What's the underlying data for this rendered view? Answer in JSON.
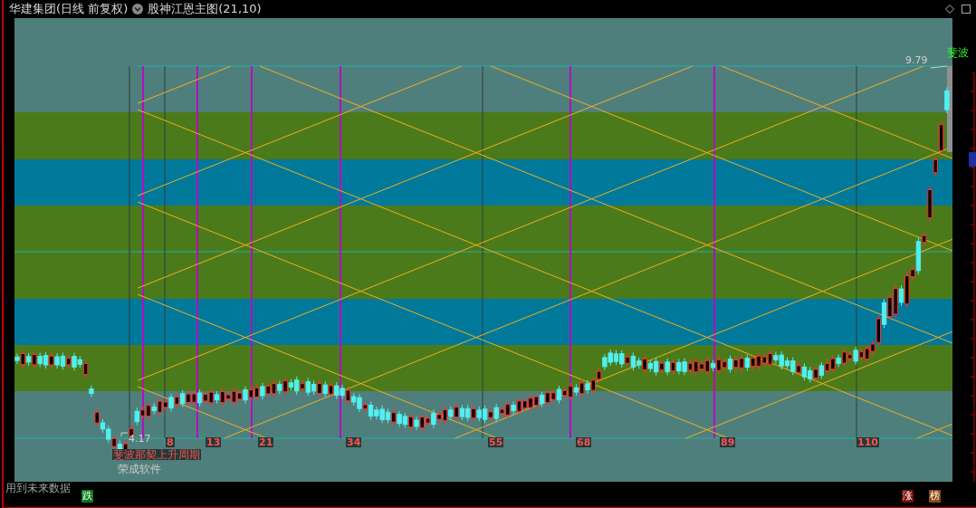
{
  "window": {
    "title": "华建集团(日线 前复权)"
  },
  "indicator": {
    "name": "股神江恩主图(21,10)"
  },
  "chart": {
    "x_labels": [
      "8",
      "13",
      "21",
      "34",
      "55",
      "68",
      "89",
      "110"
    ],
    "high_label": "9.79",
    "low_label": "4.17",
    "cycle_label": "斐波那契上升周期",
    "signature": "荣成软件",
    "edge_label": "斐波"
  },
  "notice": "用到未来数据",
  "badges": [
    {
      "label": "跌",
      "kind": "down"
    },
    {
      "label": "涨",
      "kind": "up"
    },
    {
      "label": "榜",
      "kind": "rank"
    }
  ]
}
